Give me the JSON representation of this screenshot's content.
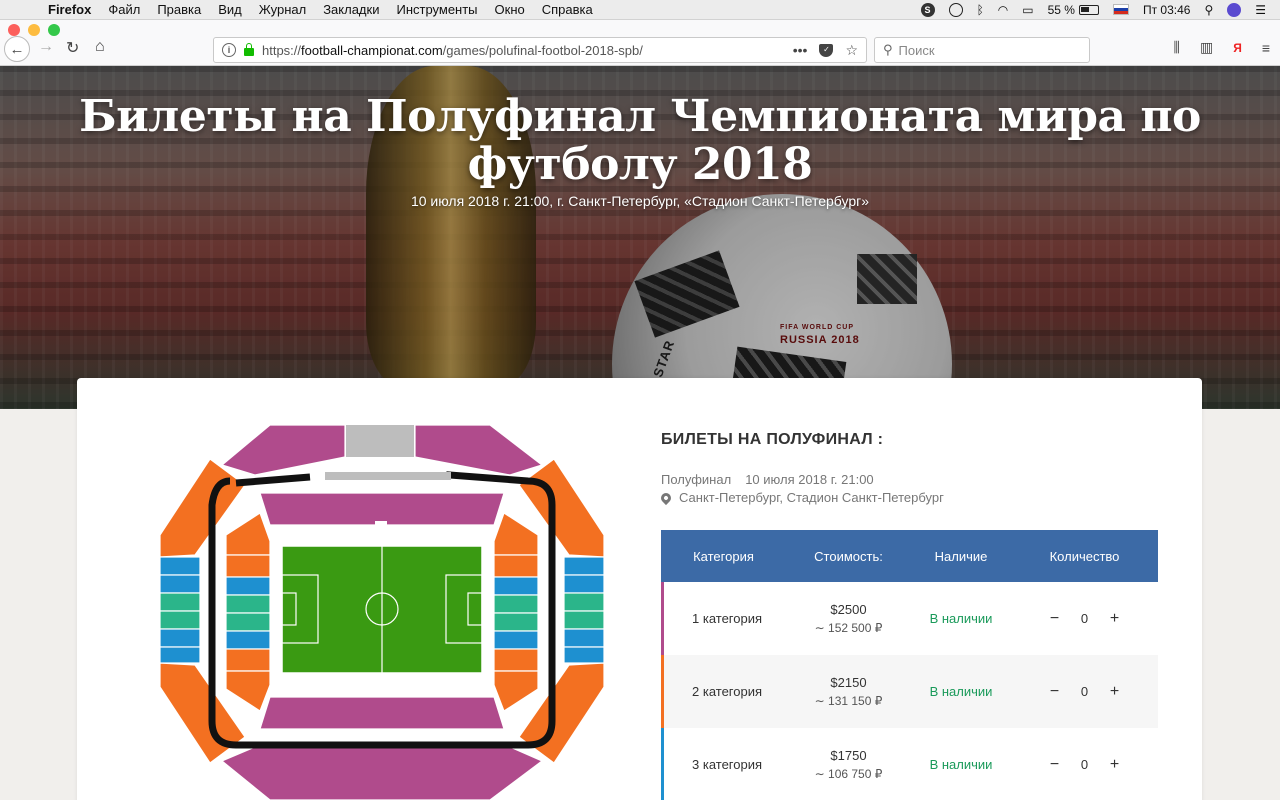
{
  "menubar": {
    "app": "Firefox",
    "items": [
      "Файл",
      "Правка",
      "Вид",
      "Журнал",
      "Закладки",
      "Инструменты",
      "Окно",
      "Справка"
    ],
    "battery": "55 %",
    "clock": "Пт 03:46"
  },
  "browser": {
    "url_prefix": "https://",
    "url_host": "football-championat.com",
    "url_path": "/games/polufinal-footbol-2018-spb/",
    "search_placeholder": "Поиск",
    "yandex_label": "Я"
  },
  "hero": {
    "title": "Билеты на Полуфинал Чемпионата мира по футболу 2018",
    "subtitle": "10 июля 2018 г. 21:00, г. Санкт-Петербург, «Стадион Санкт-Петербург»",
    "ball_text_1": "FIFA WORLD CUP",
    "ball_text_2": "RUSSIA 2018",
    "ball_brand": "TELSTAR"
  },
  "tickets": {
    "title": "БИЛЕТЫ НА ПОЛУФИНАЛ :",
    "stage": "Полуфинал",
    "date": "10 июля 2018 г. 21:00",
    "location": "Санкт-Петербург, Стадион Санкт-Петербург",
    "headers": {
      "category": "Категория",
      "price": "Стоимость:",
      "availability": "Наличие",
      "quantity": "Количество"
    },
    "rows": [
      {
        "category": "1 категория",
        "usd": "$2500",
        "rub": "∼ 152 500 ₽",
        "availability": "В наличии",
        "qty": "0",
        "color": "#b04b8c",
        "minus": "−",
        "plus": "+"
      },
      {
        "category": "2 категория",
        "usd": "$2150",
        "rub": "∼ 131 150 ₽",
        "availability": "В наличии",
        "qty": "0",
        "color": "#f37021",
        "minus": "−",
        "plus": "+"
      },
      {
        "category": "3 категория",
        "usd": "$1750",
        "rub": "∼ 106 750 ₽",
        "availability": "В наличии",
        "qty": "0",
        "color": "#1e90d0",
        "minus": "−",
        "plus": "+"
      }
    ]
  },
  "colors": {
    "cat1": "#b04b8c",
    "cat2": "#f37021",
    "cat3": "#1e90d0",
    "cat4": "#2bb58a",
    "pitch": "#3a9a12",
    "header": "#3c6aa6",
    "available": "#1a9a5a"
  }
}
